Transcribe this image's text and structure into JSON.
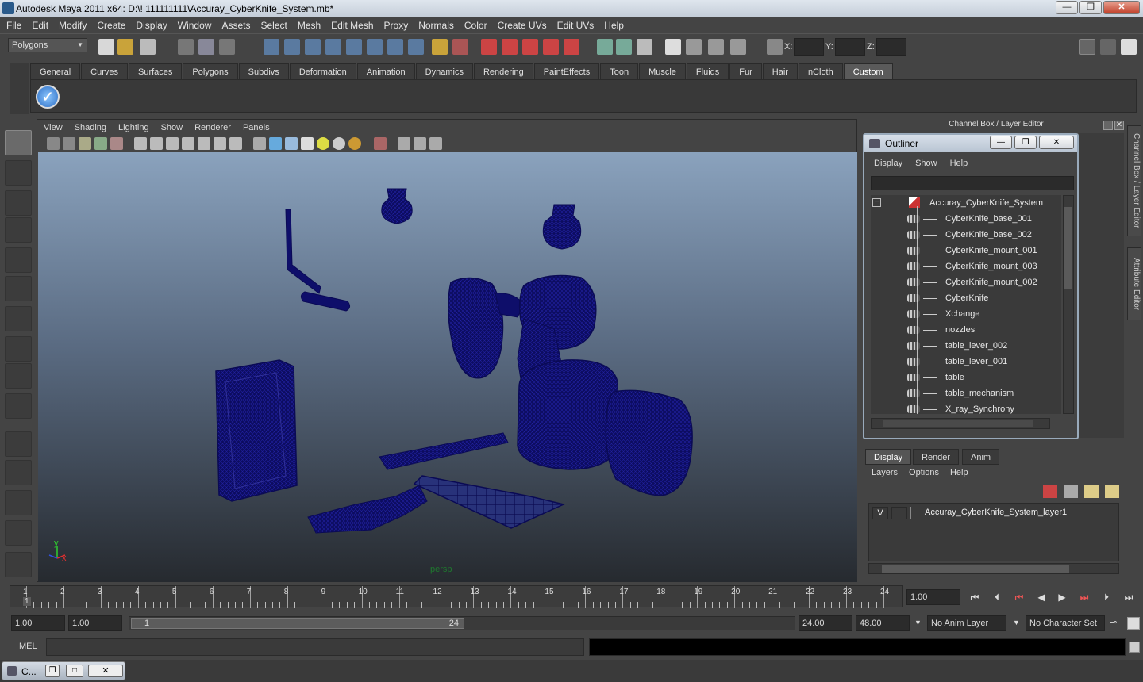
{
  "window": {
    "title": "Autodesk Maya 2011 x64: D:\\! 111111111\\Accuray_CyberKnife_System.mb*",
    "min": "—",
    "max": "❐",
    "close": "✕"
  },
  "menubar": [
    "File",
    "Edit",
    "Modify",
    "Create",
    "Display",
    "Window",
    "Assets",
    "Select",
    "Mesh",
    "Edit Mesh",
    "Proxy",
    "Normals",
    "Color",
    "Create UVs",
    "Edit UVs",
    "Help"
  ],
  "status": {
    "mode": "Polygons",
    "x_label": "X:",
    "y_label": "Y:",
    "z_label": "Z:"
  },
  "shelf": {
    "tabs": [
      "General",
      "Curves",
      "Surfaces",
      "Polygons",
      "Subdivs",
      "Deformation",
      "Animation",
      "Dynamics",
      "Rendering",
      "PaintEffects",
      "Toon",
      "Muscle",
      "Fluids",
      "Fur",
      "Hair",
      "nCloth",
      "Custom"
    ],
    "active_tab": "Custom"
  },
  "viewport": {
    "menu": [
      "View",
      "Shading",
      "Lighting",
      "Show",
      "Renderer",
      "Panels"
    ],
    "camera_label": "persp",
    "axis_x": "x",
    "axis_y": "y",
    "wire_color": "#10107a"
  },
  "channel_box_title": "Channel Box / Layer Editor",
  "side_tabs": [
    "Channel Box / Layer Editor",
    "Attribute Editor"
  ],
  "outliner": {
    "title": "Outliner",
    "menu": [
      "Display",
      "Show",
      "Help"
    ],
    "root": "Accuray_CyberKnife_System",
    "items": [
      "CyberKnife_base_001",
      "CyberKnife_base_002",
      "CyberKnife_mount_001",
      "CyberKnife_mount_003",
      "CyberKnife_mount_002",
      "CyberKnife",
      "Xchange",
      "nozzles",
      "table_lever_002",
      "table_lever_001",
      "table",
      "table_mechanism",
      "X_ray_Synchrony"
    ]
  },
  "layers": {
    "tabs": [
      "Display",
      "Render",
      "Anim"
    ],
    "menu": [
      "Layers",
      "Options",
      "Help"
    ],
    "visibility": "V",
    "layer_name": "Accuray_CyberKnife_System_layer1"
  },
  "timeline": {
    "ticks": [
      "1",
      "2",
      "3",
      "4",
      "5",
      "6",
      "7",
      "8",
      "9",
      "10",
      "11",
      "12",
      "13",
      "14",
      "15",
      "16",
      "17",
      "18",
      "19",
      "20",
      "21",
      "22",
      "23",
      "24"
    ],
    "current_frame_marker": "1",
    "current_time": "1.00"
  },
  "range": {
    "start": "1.00",
    "playback_start": "1.00",
    "slider_start": "1",
    "slider_end": "24",
    "playback_end": "24.00",
    "end": "48.00",
    "anim_layer": "No Anim Layer",
    "character_set": "No Character Set"
  },
  "mel_label": "MEL",
  "taskbar_item": "C..."
}
